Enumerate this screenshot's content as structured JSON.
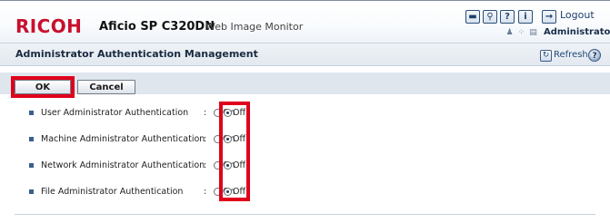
{
  "header": {
    "brand": "RICOH",
    "model": "Aficio SP C320DN",
    "product": "Web Image Monitor",
    "logout_label": "Logout",
    "user": "Administrator",
    "toolbar_icons": [
      "monitor-icon",
      "search-icon",
      "question-icon",
      "info-icon",
      "logout-arrow-icon"
    ],
    "colors": {
      "brand": "#c8102e",
      "accent": "#1e3e6c"
    }
  },
  "titlebar": {
    "title": "Administrator Authentication Management",
    "refresh_label": "Refresh"
  },
  "buttons": {
    "ok": "OK",
    "cancel": "Cancel"
  },
  "options": {
    "on": "On",
    "off": "Off"
  },
  "settings": [
    {
      "label": "User Administrator Authentication",
      "value": "Off"
    },
    {
      "label": "Machine Administrator Authentication",
      "value": "Off"
    },
    {
      "label": "Network Administrator Authentication",
      "value": "Off"
    },
    {
      "label": "File Administrator Authentication",
      "value": "Off"
    }
  ],
  "highlight_color": "#e0001b"
}
